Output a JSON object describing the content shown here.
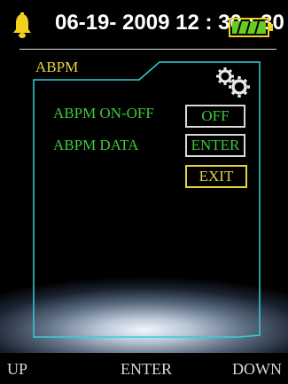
{
  "header": {
    "datetime": "06-19- 2009 12 : 30 : 30",
    "bell_icon": "bell-icon",
    "battery_icon": "battery-icon",
    "battery_level": 1.0
  },
  "panel": {
    "title": "ABPM",
    "settings_icon": "gears-icon"
  },
  "rows": [
    {
      "label": "ABPM ON-OFF",
      "value": "OFF"
    },
    {
      "label": "ABPM DATA",
      "value": "ENTER"
    }
  ],
  "exit_label": "EXIT",
  "softkeys": {
    "up": "UP",
    "enter": "ENTER",
    "down": "DOWN"
  },
  "colors": {
    "accent_yellow": "#e8d23a",
    "text_green": "#3cc83c",
    "panel_cyan": "#33d0d8",
    "frame_white": "#d8d8d8"
  }
}
